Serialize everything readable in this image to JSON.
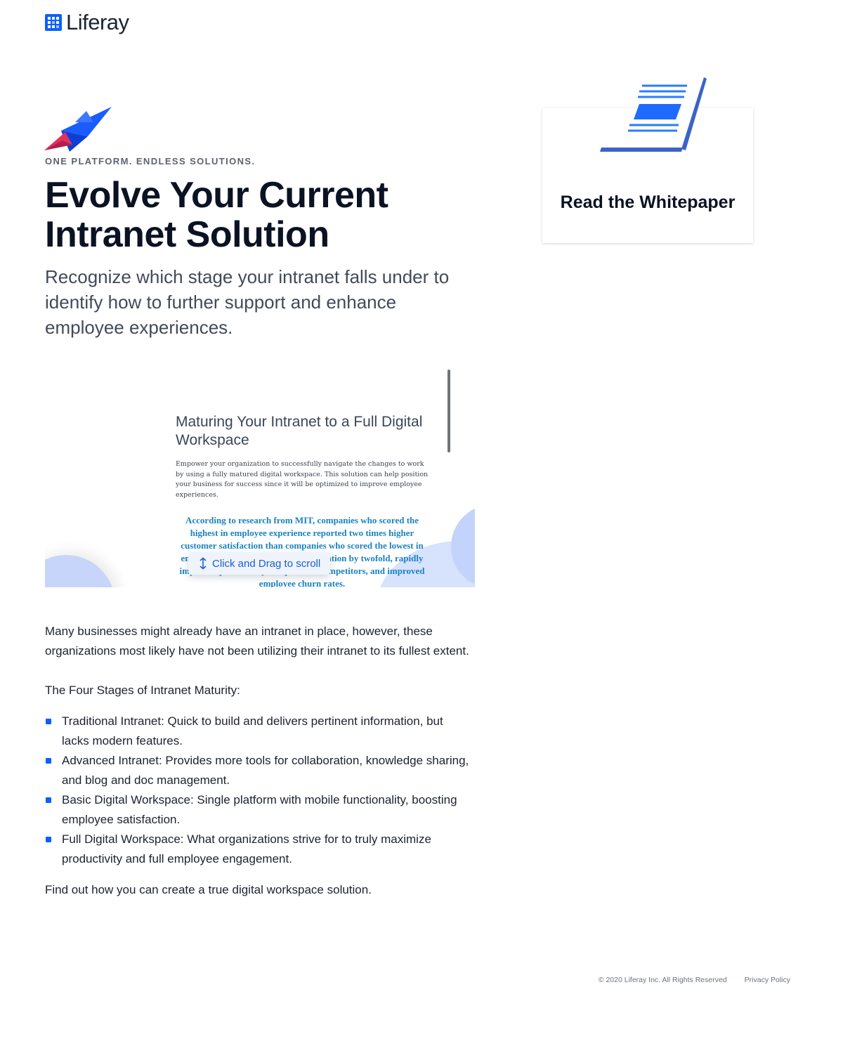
{
  "brand": {
    "name": "Liferay",
    "accent": "#0b5fff"
  },
  "hero": {
    "eyebrow": "ONE PLATFORM. ENDLESS SOLUTIONS.",
    "title": "Evolve Your Current Intranet Solution",
    "subtitle": "Recognize which stage your intranet falls under to identify how to further support and enhance employee experiences."
  },
  "preview": {
    "doc_title": "Maturing Your Intranet to a Full Digital Workspace",
    "doc_body": "Empower your organization to successfully navigate the changes to work by using a fully matured digital workspace. This solution can help position your business for success since it will be optimized to improve employee experiences.",
    "doc_quote": "According to research from MIT, companies who scored the highest in employee experience reported two times higher customer satisfaction than companies who scored the lowest in employee experience, increased innovation by twofold, rapidly improved profitability compared to competitors, and improved employee churn rates.",
    "drag_hint": "Click and Drag to scroll",
    "drag_icon": "vertical-arrows-icon"
  },
  "whitepaper": {
    "label": "Read the Whitepaper",
    "icon": "laptop-document-icon"
  },
  "content": {
    "intro": "Many businesses might already have an intranet in place, however, these organizations most likely have not been utilizing their intranet to its fullest extent.",
    "stages_heading": "The Four Stages of Intranet Maturity:",
    "stages": [
      "Traditional Intranet: Quick to build and delivers pertinent information, but lacks modern features.",
      "Advanced Intranet: Provides more tools for collaboration, knowledge sharing, and blog and doc management.",
      "Basic Digital Workspace: Single platform with mobile functionality, boosting employee satisfaction.",
      "Full Digital Workspace: What organizations strive for to truly maximize productivity and full employee engagement."
    ],
    "cta": "Find out how you can create a true digital workspace solution."
  },
  "footer": {
    "copyright": "© 2020 Liferay Inc. All Rights Reserved",
    "privacy": "Privacy Policy"
  }
}
